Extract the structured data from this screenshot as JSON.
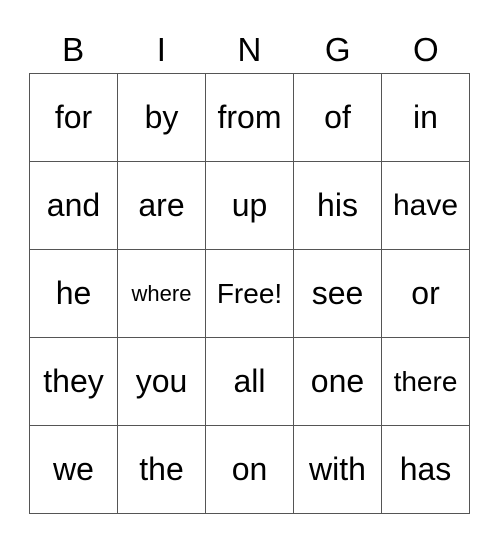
{
  "header": {
    "letters": [
      "B",
      "I",
      "N",
      "G",
      "O"
    ]
  },
  "grid": {
    "rows": [
      [
        "for",
        "by",
        "from",
        "of",
        "in"
      ],
      [
        "and",
        "are",
        "up",
        "his",
        "have"
      ],
      [
        "he",
        "where",
        "Free!",
        "see",
        "or"
      ],
      [
        "they",
        "you",
        "all",
        "one",
        "there"
      ],
      [
        "we",
        "the",
        "on",
        "with",
        "has"
      ]
    ]
  }
}
